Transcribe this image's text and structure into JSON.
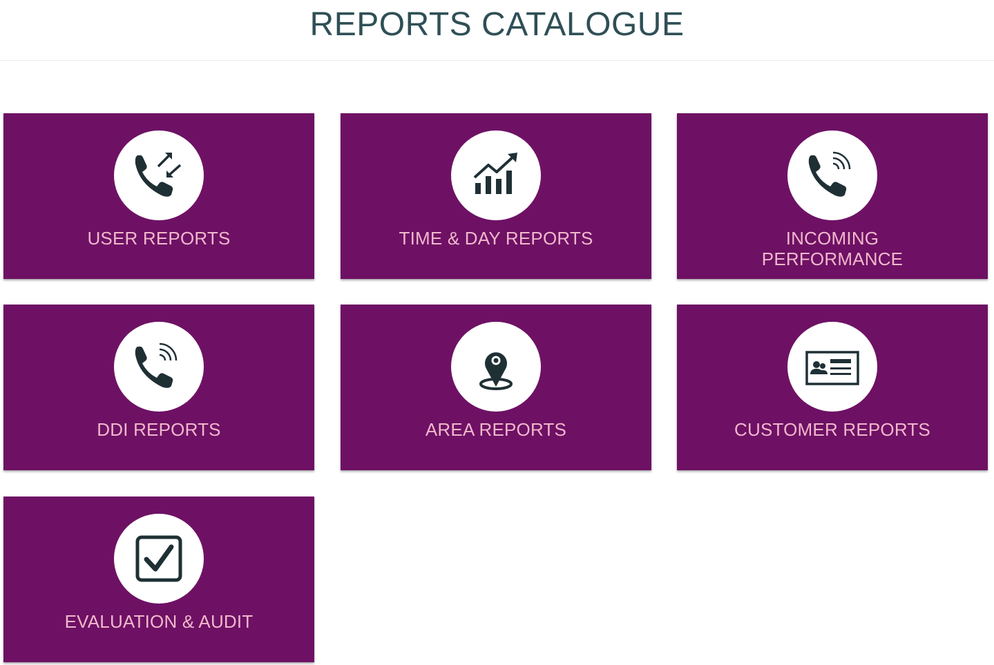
{
  "header": {
    "title": "REPORTS CATALOGUE"
  },
  "colors": {
    "tile_background": "#6e1164",
    "tile_label": "#f0b8cc",
    "icon": "#1f3035",
    "title": "#2f4f56"
  },
  "tiles": [
    {
      "label": "USER REPORTS",
      "icon": "phone-transfer-icon"
    },
    {
      "label": "TIME & DAY REPORTS",
      "icon": "growth-chart-icon"
    },
    {
      "label": "INCOMING\nPERFORMANCE",
      "icon": "phone-ringing-icon"
    },
    {
      "label": "DDI REPORTS",
      "icon": "phone-ringing-icon"
    },
    {
      "label": "AREA REPORTS",
      "icon": "map-pin-icon"
    },
    {
      "label": "CUSTOMER REPORTS",
      "icon": "id-card-icon"
    },
    {
      "label": "EVALUATION & AUDIT",
      "icon": "checkbox-icon"
    }
  ]
}
